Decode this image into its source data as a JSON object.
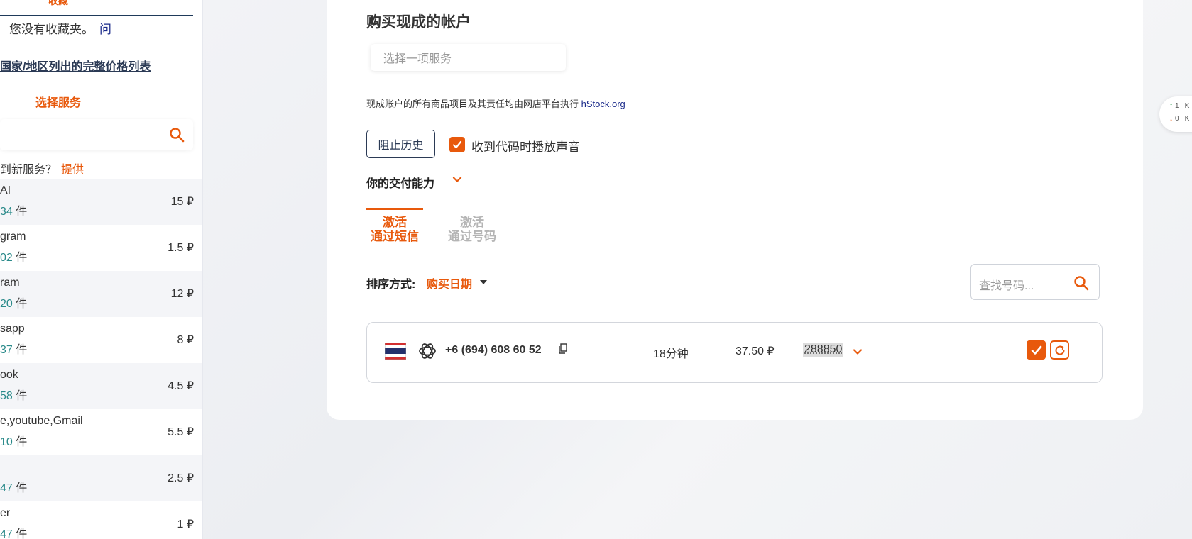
{
  "sidebar": {
    "favorites_title": "收藏",
    "no_favorites": "您没有收藏夹。",
    "question_mark": "问",
    "price_list_link": "国家/地区列出的完整价格列表",
    "select_service": "选择服务",
    "new_service_text": "到新服务？",
    "new_service_link": "提供",
    "unit": "件",
    "services": [
      {
        "name": "AI",
        "count": "34",
        "price": "15 ₽"
      },
      {
        "name": "gram",
        "count": "02",
        "price": "1.5 ₽"
      },
      {
        "name": "ram",
        "count": "20",
        "price": "12 ₽"
      },
      {
        "name": "sapp",
        "count": "37",
        "price": "8 ₽"
      },
      {
        "name": "ook",
        "count": "58",
        "price": "4.5 ₽"
      },
      {
        "name": "e,youtube,Gmail",
        "count": "10",
        "price": "5.5 ₽"
      },
      {
        "name": "",
        "count": "47",
        "price": "2.5 ₽"
      },
      {
        "name": "er",
        "count": "47",
        "price": "1 ₽"
      }
    ]
  },
  "main": {
    "title": "购买现成的帐户",
    "service_placeholder": "选择一项服务",
    "notice_text": "现成账户的所有商品项目及其责任均由网店平台执行",
    "notice_link": "hStock.org",
    "block_history": "阻止历史",
    "sound_checkbox_label": "收到代码时播放声音",
    "sound_checked": true,
    "delivery_label": "你的交付能力",
    "tabs": [
      {
        "line1": "激活",
        "line2": "通过短信",
        "active": true
      },
      {
        "line1": "激活",
        "line2": "通过号码",
        "active": false
      }
    ],
    "sort_label": "排序方式:",
    "sort_value": "购买日期",
    "number_search_placeholder": "查找号码...",
    "orders": [
      {
        "country_flag": "thailand-flag",
        "service_icon": "openai-icon",
        "phone": "+6 (694) 608 60 52",
        "elapsed": "18分钟",
        "price": "37.50 ₽",
        "code": "288850"
      }
    ]
  },
  "widget": {
    "up_count": "1",
    "down_count": "0",
    "up_suffix": "K",
    "down_suffix": "K"
  },
  "colors": {
    "accent": "#e8590c",
    "navy": "#2b3a55",
    "teal": "#2a8a8a"
  }
}
